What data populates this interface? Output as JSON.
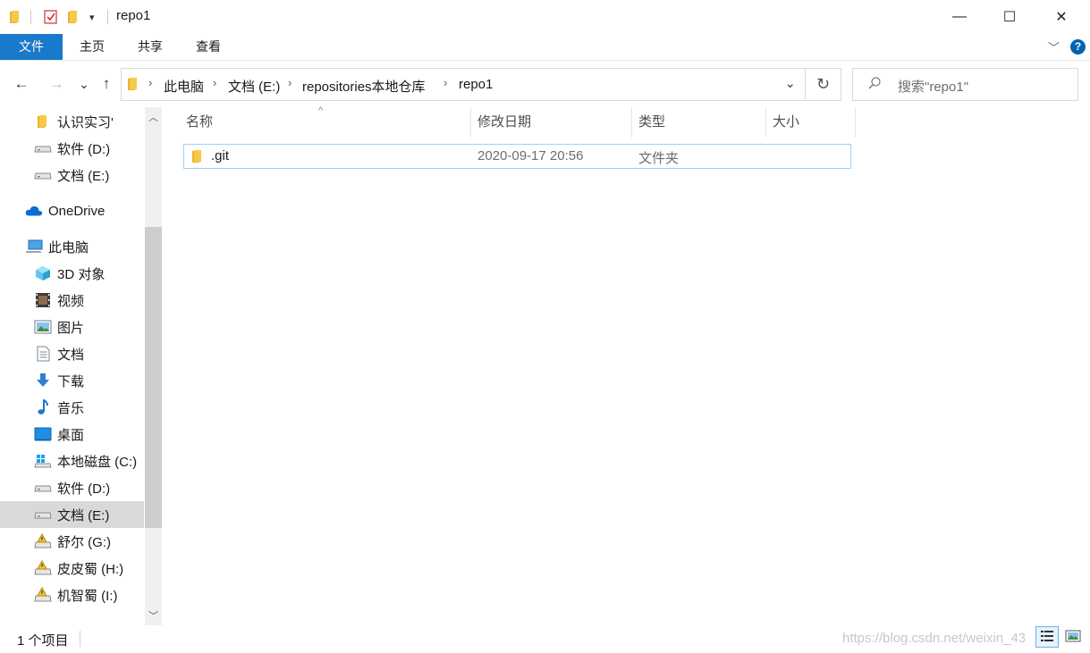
{
  "window": {
    "title": "repo1",
    "minimize_glyph": "—",
    "maximize_glyph": "☐",
    "close_glyph": "✕",
    "quick_access_dropdown": "▾"
  },
  "ribbon": {
    "tabs": [
      "文件",
      "主页",
      "共享",
      "查看"
    ],
    "help_glyph": "?",
    "expand_glyph": "﹀"
  },
  "nav": {
    "back_glyph": "←",
    "forward_glyph": "→",
    "recent_glyph": "⌄",
    "up_glyph": "↑",
    "breadcrumbs": [
      "此电脑",
      "文档 (E:)",
      "repositories本地仓库",
      "repo1"
    ],
    "crumb_sep": "›",
    "dropdown_glyph": "⌄",
    "refresh_glyph": "↻",
    "search_placeholder": "搜索\"repo1\"",
    "search_glyph": "⌕"
  },
  "sidebar": {
    "items": [
      {
        "label": "认识实习'",
        "icon": "folder-icon"
      },
      {
        "label": "软件 (D:)",
        "icon": "drive-icon"
      },
      {
        "label": "文档 (E:)",
        "icon": "drive-icon"
      },
      {
        "label": "OneDrive",
        "icon": "cloud-icon"
      },
      {
        "label": "此电脑",
        "icon": "computer-icon"
      },
      {
        "label": "3D 对象",
        "icon": "cube-icon"
      },
      {
        "label": "视频",
        "icon": "video-icon"
      },
      {
        "label": "图片",
        "icon": "picture-icon"
      },
      {
        "label": "文档",
        "icon": "document-icon"
      },
      {
        "label": "下载",
        "icon": "download-icon"
      },
      {
        "label": "音乐",
        "icon": "music-icon"
      },
      {
        "label": "桌面",
        "icon": "desktop-icon"
      },
      {
        "label": "本地磁盘 (C:)",
        "icon": "windows-drive-icon"
      },
      {
        "label": "软件 (D:)",
        "icon": "drive-icon"
      },
      {
        "label": "文档 (E:)",
        "icon": "drive-icon"
      },
      {
        "label": "舒尔 (G:)",
        "icon": "locked-drive-icon"
      },
      {
        "label": "皮皮蜀 (H:)",
        "icon": "locked-drive-icon"
      },
      {
        "label": "机智蜀 (I:)",
        "icon": "locked-drive-icon"
      }
    ],
    "selected_index": 14,
    "scroll_up_glyph": "︿",
    "scroll_down_glyph": "﹀"
  },
  "content": {
    "columns": [
      "名称",
      "修改日期",
      "类型",
      "大小"
    ],
    "sort_glyph": "^",
    "rows": [
      {
        "name": ".git",
        "modified": "2020-09-17 20:56",
        "type": "文件夹",
        "size": ""
      }
    ]
  },
  "status": {
    "item_count": "1 个项目",
    "watermark": "https://blog.csdn.net/weixin_43"
  },
  "colors": {
    "accent": "#1979ca",
    "selection_border": "#99d1ff",
    "folder": "#f7c948"
  }
}
